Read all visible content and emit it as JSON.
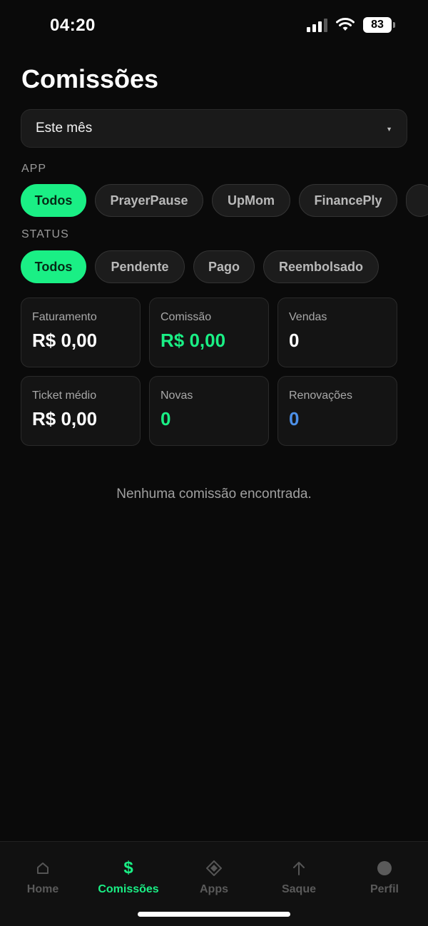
{
  "status": {
    "time": "04:20",
    "battery": "83"
  },
  "page": {
    "title": "Comissões"
  },
  "period": {
    "selected": "Este mês"
  },
  "filters": {
    "app_label": "APP",
    "apps": [
      "Todos",
      "PrayerPause",
      "UpMom",
      "FinancePly"
    ],
    "status_label": "STATUS",
    "statuses": [
      "Todos",
      "Pendente",
      "Pago",
      "Reembolsado"
    ]
  },
  "stats": [
    {
      "label": "Faturamento",
      "value": "R$ 0,00"
    },
    {
      "label": "Comissão",
      "value": "R$ 0,00"
    },
    {
      "label": "Vendas",
      "value": "0"
    },
    {
      "label": "Ticket médio",
      "value": "R$ 0,00"
    },
    {
      "label": "Novas",
      "value": "0"
    },
    {
      "label": "Renovações",
      "value": "0"
    }
  ],
  "empty_state": "Nenhuma comissão encontrada.",
  "nav": [
    {
      "label": "Home",
      "icon": "home-icon"
    },
    {
      "label": "Comissões",
      "icon": "dollar-icon"
    },
    {
      "label": "Apps",
      "icon": "diamond-icon"
    },
    {
      "label": "Saque",
      "icon": "arrow-up-icon"
    },
    {
      "label": "Perfil",
      "icon": "profile-circle-icon"
    }
  ],
  "colors": {
    "accent": "#1aef85",
    "blue": "#4d90e8",
    "background": "#0a0a0a"
  }
}
